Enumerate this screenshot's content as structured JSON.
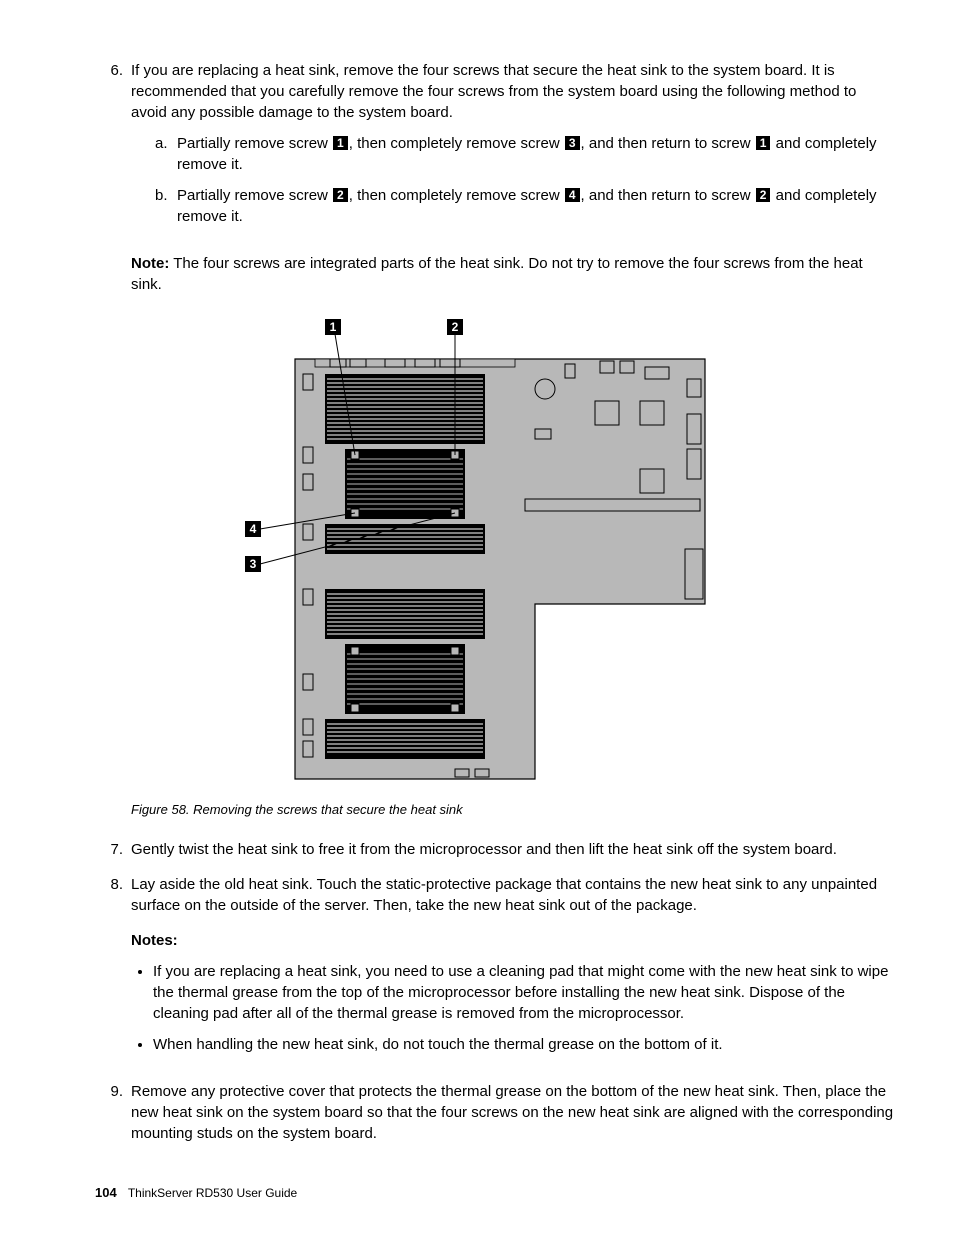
{
  "steps": {
    "s6": {
      "num": "6.",
      "text": "If you are replacing a heat sink, remove the four screws that secure the heat sink to the system board. It is recommended that you carefully remove the four screws from the system board using the following method to avoid any possible damage to the system board.",
      "a": {
        "alpha": "a.",
        "before": "Partially remove screw ",
        "c1": "1",
        "mid1": ", then completely remove screw ",
        "c2": "3",
        "mid2": ", and then return to screw ",
        "c3": "1",
        "after": " and completely remove it."
      },
      "b": {
        "alpha": "b.",
        "before": "Partially remove screw ",
        "c1": "2",
        "mid1": ", then completely remove screw ",
        "c2": "4",
        "mid2": ", and then return to screw ",
        "c3": "2",
        "after": " and completely remove it."
      }
    },
    "note1_label": "Note:",
    "note1_text": " The four screws are integrated parts of the heat sink. Do not try to remove the four screws from the heat sink.",
    "figure_caption": "Figure 58.  Removing the screws that secure the heat sink",
    "s7": {
      "num": "7.",
      "text": "Gently twist the heat sink to free it from the microprocessor and then lift the heat sink off the system board."
    },
    "s8": {
      "num": "8.",
      "text": "Lay aside the old heat sink. Touch the static-protective package that contains the new heat sink to any unpainted surface on the outside of the server. Then, take the new heat sink out of the package."
    },
    "notes_label": "Notes:",
    "bullet1": "If you are replacing a heat sink, you need to use a cleaning pad that might come with the new heat sink to wipe the thermal grease from the top of the microprocessor before installing the new heat sink. Dispose of the cleaning pad after all of the thermal grease is removed from the microprocessor.",
    "bullet2": "When handling the new heat sink, do not touch the thermal grease on the bottom of it.",
    "s9": {
      "num": "9.",
      "text": "Remove any protective cover that protects the thermal grease on the bottom of the new heat sink. Then, place the new heat sink on the system board so that the four screws on the new heat sink are aligned with the corresponding mounting studs on the system board."
    }
  },
  "diagram_labels": {
    "l1": "1",
    "l2": "2",
    "l3": "3",
    "l4": "4"
  },
  "footer": {
    "page": "104",
    "title": "ThinkServer RD530 User Guide"
  }
}
